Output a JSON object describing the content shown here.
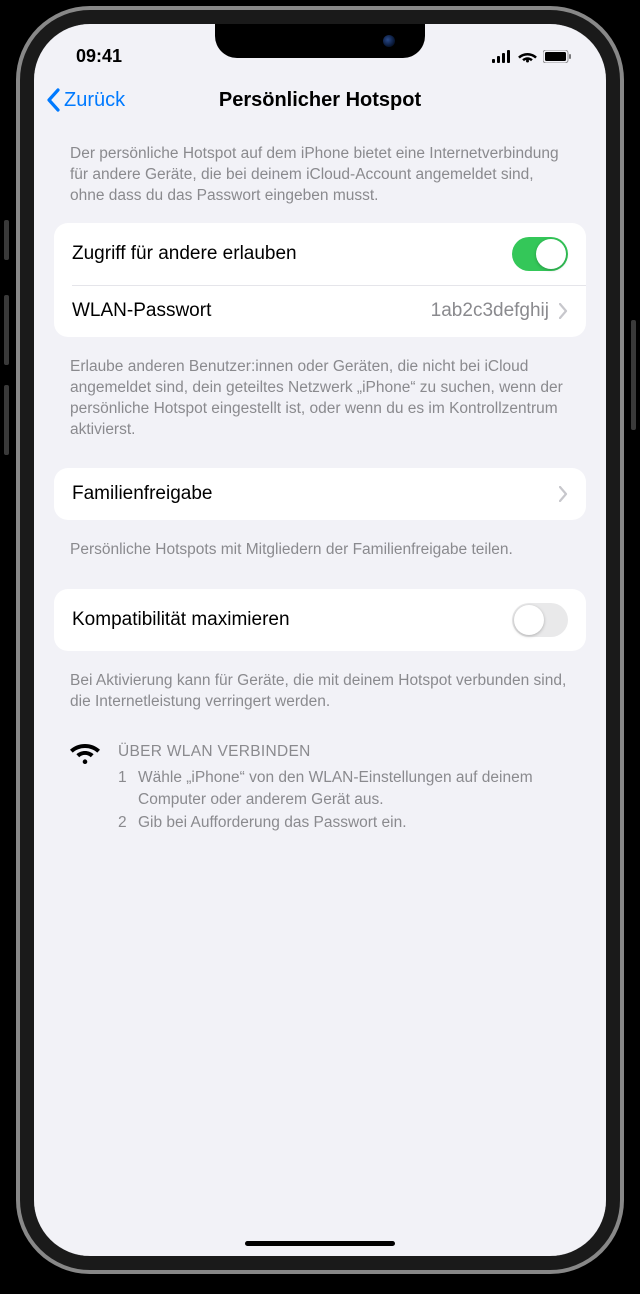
{
  "statusBar": {
    "time": "09:41"
  },
  "nav": {
    "back": "Zurück",
    "title": "Persönlicher Hotspot"
  },
  "intro": "Der persönliche Hotspot auf dem iPhone bietet eine Internetverbindung für andere Geräte, die bei deinem iCloud-Account angemeldet sind, ohne dass du das Passwort eingeben musst.",
  "section1": {
    "allowOthers": {
      "label": "Zugriff für andere erlauben",
      "on": true
    },
    "wifiPassword": {
      "label": "WLAN-Passwort",
      "value": "1ab2c3defghij"
    }
  },
  "allowFooter": "Erlaube anderen Benutzer:innen oder Geräten, die nicht bei iCloud angemeldet sind, dein geteiltes Netzwerk „iPhone“ zu suchen, wenn der persönliche Hotspot eingestellt ist, oder wenn du es im Kontrollzentrum aktivierst.",
  "familySharing": {
    "label": "Familienfreigabe"
  },
  "familyFooter": "Persönliche Hotspots mit Mitgliedern der Familienfreigabe teilen.",
  "maxCompat": {
    "label": "Kompatibilität maximieren",
    "on": false
  },
  "maxCompatFooter": "Bei Aktivierung kann für Geräte, die mit deinem Hotspot verbunden sind, die Internetleistung verringert werden.",
  "instructions": {
    "title": "ÜBER WLAN VERBINDEN",
    "step1num": "1",
    "step1": "Wähle „iPhone“ von den WLAN-Einstellungen auf deinem Computer oder anderem Gerät aus.",
    "step2num": "2",
    "step2": "Gib bei Aufforderung das Passwort ein."
  }
}
